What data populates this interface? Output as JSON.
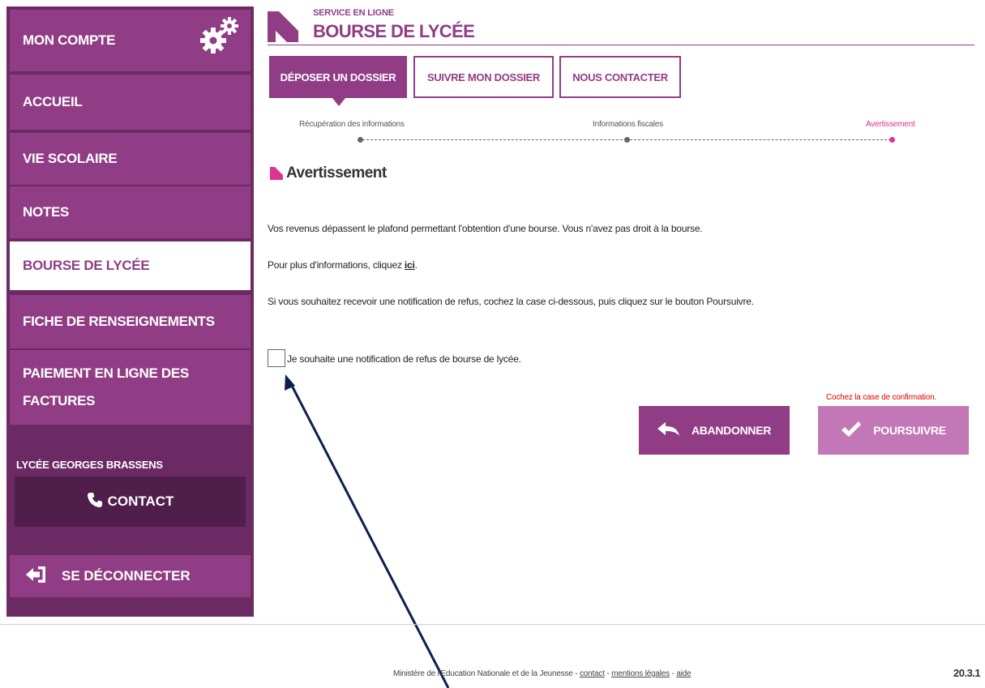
{
  "sidebar": {
    "items": [
      {
        "label": "MON COMPTE"
      },
      {
        "label": "ACCUEIL"
      },
      {
        "label": "VIE SCOLAIRE"
      },
      {
        "label": "NOTES"
      },
      {
        "label": "BOURSE DE LYCÉE",
        "active": true
      },
      {
        "label": "FICHE DE RENSEIGNEMENTS"
      },
      {
        "label_line1": "PAIEMENT EN LIGNE DES",
        "label_line2": "FACTURES"
      }
    ],
    "school_name": "LYCÉE GEORGES BRASSENS",
    "contact_label": "CONTACT",
    "logout_label": "SE DÉCONNECTER",
    "colors": {
      "base": "#6b2a64",
      "item": "#903d86",
      "contact": "#4f1e4a"
    }
  },
  "header": {
    "service_label": "SERVICE EN LIGNE",
    "service_title": "BOURSE DE LYCÉE"
  },
  "tabs": [
    {
      "label": "DÉPOSER UN DOSSIER",
      "active": true
    },
    {
      "label": "SUIVRE MON DOSSIER"
    },
    {
      "label": "NOUS CONTACTER"
    }
  ],
  "stepper": {
    "steps": [
      {
        "label": "Récupération des informations"
      },
      {
        "label": "Informations fiscales"
      },
      {
        "label": "Avertissement",
        "current": true
      }
    ]
  },
  "content": {
    "section_title": "Avertissement",
    "paragraph1": "Vos revenus dépassent le plafond permettant l'obtention d'une bourse. Vous n'avez pas droit à la bourse.",
    "paragraph2_prefix": "Pour plus d'informations, cliquez ",
    "paragraph2_link": "ici",
    "paragraph2_suffix": ".",
    "paragraph3": "Si vous souhaitez recevoir une notification de refus, cochez la case ci-dessous, puis cliquez sur le bouton Poursuivre.",
    "checkbox_label": "Je souhaite une notification de refus de bourse de lycée.",
    "checkbox_checked": false,
    "error_message": "Cochez la case de confirmation.",
    "abandon_label": "ABANDONNER",
    "continue_label": "POURSUIVRE"
  },
  "footer": {
    "ministry": "Ministère de l'Education Nationale et de la Jeunesse",
    "separator": " - ",
    "link_contact": "contact",
    "link_legal": "mentions légales",
    "link_help": "aide",
    "version": "20.3.1"
  },
  "colors": {
    "accent": "#903d86",
    "step_current": "#e0338f",
    "error": "#e00000",
    "annotation_arrow": "#0d1f4f"
  }
}
